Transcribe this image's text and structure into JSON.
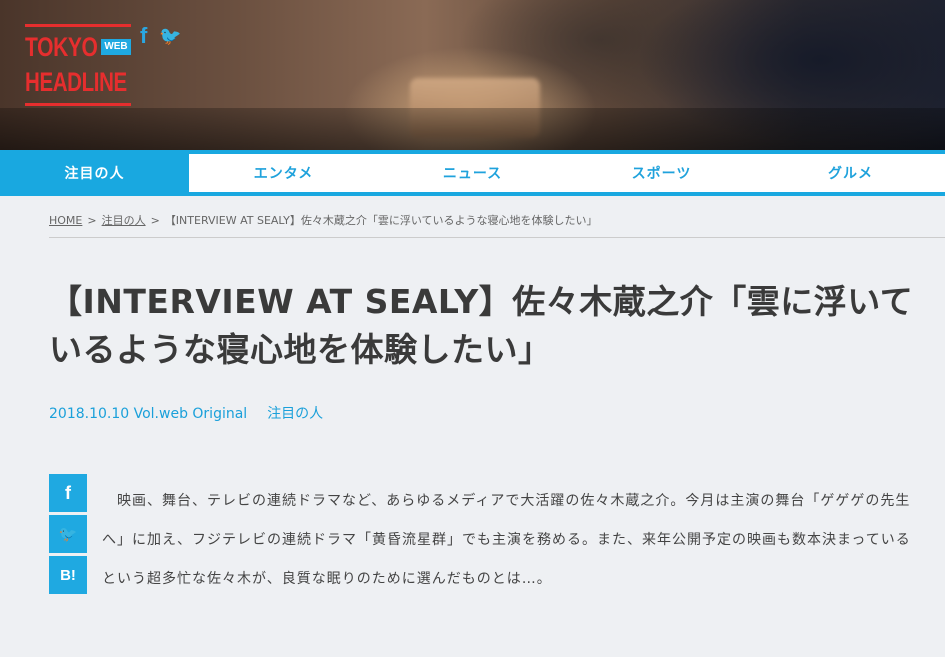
{
  "header": {
    "logo": {
      "line1": "TOKYO",
      "badge": "WEB",
      "line2": "HEADLINE"
    },
    "social": [
      {
        "icon": "facebook-icon",
        "glyph": "f"
      },
      {
        "icon": "twitter-icon",
        "glyph": "🐦"
      }
    ]
  },
  "nav": {
    "items": [
      {
        "label": "注目の人",
        "active": true
      },
      {
        "label": "エンタメ"
      },
      {
        "label": "ニュース"
      },
      {
        "label": "スポーツ"
      },
      {
        "label": "グルメ"
      }
    ]
  },
  "breadcrumb": {
    "home": "HOME",
    "sep": ">",
    "category": "注目の人",
    "current": "【INTERVIEW AT SEALY】佐々木蔵之介「雲に浮いているような寝心地を体験したい」"
  },
  "article": {
    "title": "【INTERVIEW AT SEALY】佐々木蔵之介「雲に浮いているような寝心地を体験したい」",
    "meta": "2018.10.10 Vol.web Original",
    "category": "注目の人",
    "body": "　映画、舞台、テレビの連続ドラマなど、あらゆるメディアで大活躍の佐々木蔵之介。今月は主演の舞台「ゲゲゲの先生へ」に加え、フジテレビの連続ドラマ「黄昏流星群」でも主演を務める。また、来年公開予定の映画も数本決まっているという超多忙な佐々木が、良質な眠りのために選んだものとは…。"
  },
  "share": [
    {
      "icon": "facebook-icon",
      "glyph": "f"
    },
    {
      "icon": "twitter-icon",
      "glyph": "🐦"
    },
    {
      "icon": "hatena-bookmark-icon",
      "glyph": "B!"
    }
  ],
  "colors": {
    "accent": "#19a8e0",
    "logo": "#e62e2e",
    "background": "#eef0f3"
  }
}
